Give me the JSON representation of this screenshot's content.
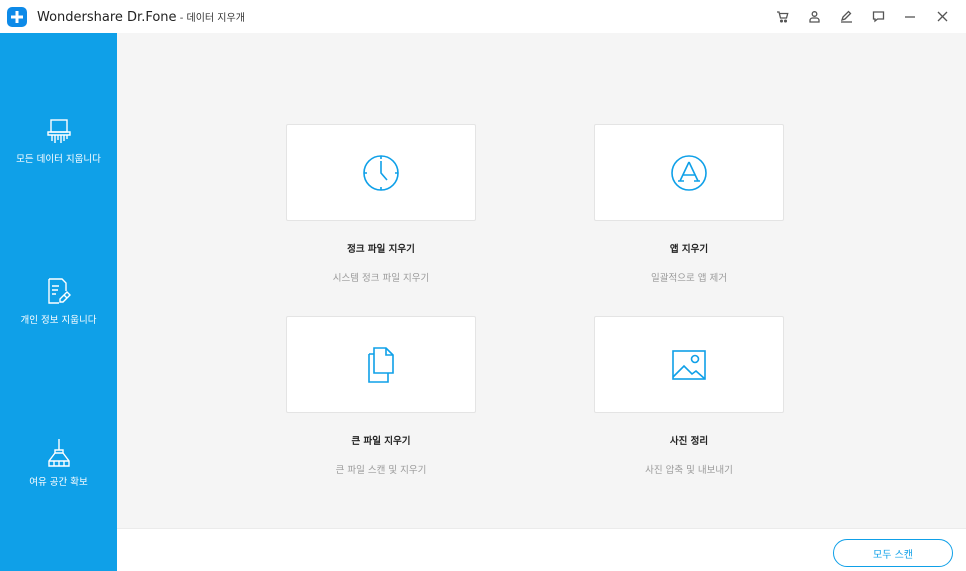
{
  "window": {
    "title": "Wondershare Dr.Fone",
    "title_separator": " - ",
    "subtitle": "데이터 지우개"
  },
  "title_controls": [
    {
      "name": "cart-icon"
    },
    {
      "name": "user-icon"
    },
    {
      "name": "edit-icon"
    },
    {
      "name": "feedback-icon"
    },
    {
      "name": "minimize-icon"
    },
    {
      "name": "close-icon"
    }
  ],
  "sidebar": {
    "items": [
      {
        "label": "모든 데이터 지웁니다",
        "icon": "shredder-icon"
      },
      {
        "label": "개인 정보 지웁니다",
        "icon": "document-erase-icon"
      },
      {
        "label": "여유 공간 확보",
        "icon": "broom-icon"
      }
    ]
  },
  "cards": [
    {
      "title": "정크 파일 지우기",
      "desc": "시스템 정크 파일 지우기",
      "icon": "clock-icon"
    },
    {
      "title": "앱 지우기",
      "desc": "일괄적으로 앱 제거",
      "icon": "app-store-icon"
    },
    {
      "title": "큰 파일 지우기",
      "desc": "큰 파일 스캔 및 지우기",
      "icon": "files-icon"
    },
    {
      "title": "사진 정리",
      "desc": "사진 압축 및 내보내기",
      "icon": "image-icon"
    }
  ],
  "footer": {
    "scan_label": "모두 스캔"
  },
  "colors": {
    "accent": "#0fa0e8",
    "sidebar_bg": "#0fa0e8",
    "main_bg": "#f5f5f5"
  }
}
